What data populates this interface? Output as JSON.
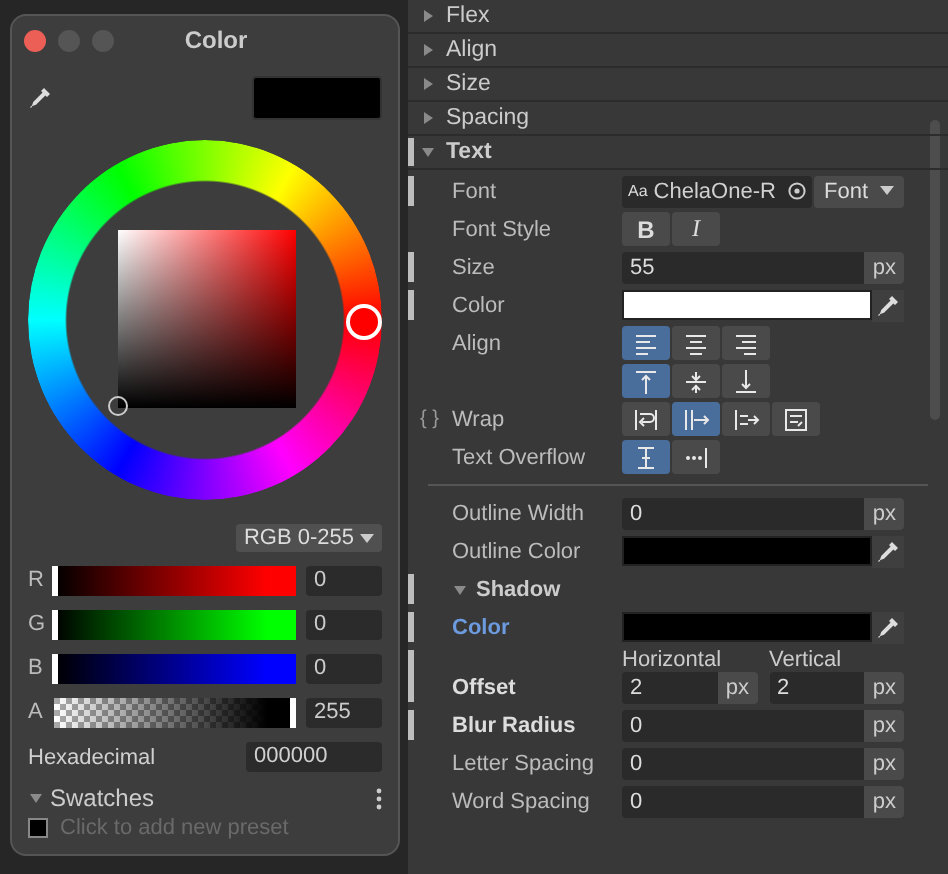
{
  "color_window": {
    "title": "Color",
    "mode": "RGB 0-255",
    "channels": [
      {
        "label": "R",
        "kind": "rgb",
        "color": "#ff0000",
        "level": 0,
        "value": "0"
      },
      {
        "label": "G",
        "kind": "rgb",
        "color": "#00ff00",
        "level": 0,
        "value": "0"
      },
      {
        "label": "B",
        "kind": "rgb",
        "color": "#0000ff",
        "level": 0,
        "value": "0"
      },
      {
        "label": "A",
        "kind": "alpha",
        "color": "#000000",
        "level": 1,
        "value": "255"
      }
    ],
    "hex_label": "Hexadecimal",
    "hex_value": "000000",
    "swatches": {
      "label": "Swatches",
      "expanded": true,
      "hint": "Click to add new preset"
    }
  },
  "inspector": {
    "sections": [
      {
        "label": "Flex",
        "expanded": false,
        "modified": false
      },
      {
        "label": "Align",
        "expanded": false,
        "modified": false
      },
      {
        "label": "Size",
        "expanded": false,
        "modified": false
      },
      {
        "label": "Spacing",
        "expanded": false,
        "modified": false
      },
      {
        "label": "Text",
        "expanded": true,
        "modified": true
      }
    ],
    "properties": [
      {
        "kind": "font",
        "label": "Font",
        "modified": true,
        "prefix": "Aa",
        "value": "ChelaOne-R",
        "button": "Font"
      },
      {
        "kind": "buttons",
        "label": "Font Style",
        "modified": false,
        "buttons": [
          {
            "text": "B",
            "selected": false,
            "italic": false
          },
          {
            "text": "I",
            "selected": false,
            "italic": true
          }
        ]
      },
      {
        "kind": "number",
        "label": "Size",
        "modified": true,
        "value": "55",
        "unit": "px"
      },
      {
        "kind": "color",
        "label": "Color",
        "modified": true,
        "color": "#ffffff"
      },
      {
        "kind": "h-align",
        "label": "Align",
        "modified": false,
        "icons": [
          {
            "selected": true
          },
          {
            "selected": false
          },
          {
            "selected": false
          }
        ]
      },
      {
        "kind": "v-align",
        "icons": [
          {
            "selected": true
          },
          {
            "selected": false
          },
          {
            "selected": false
          }
        ]
      },
      {
        "kind": "wrap",
        "label": "Wrap",
        "binding": "{ }",
        "modified": false,
        "icons": [
          {
            "selected": false
          },
          {
            "selected": true
          },
          {
            "selected": false
          },
          {
            "selected": false
          }
        ]
      },
      {
        "kind": "overflow",
        "label": "Text Overflow",
        "modified": false,
        "icons": [
          {
            "selected": true
          },
          {
            "selected": false
          }
        ]
      },
      {
        "kind": "divider"
      },
      {
        "kind": "number",
        "label": "Outline Width",
        "modified": false,
        "value": "0",
        "unit": "px"
      },
      {
        "kind": "color",
        "label": "Outline Color",
        "modified": false,
        "color": "#000000"
      },
      {
        "kind": "subsection",
        "label": "Shadow",
        "expanded": true,
        "modified": true
      },
      {
        "kind": "color",
        "label": "Color",
        "modified": true,
        "highlight": true,
        "color": "#000000"
      },
      {
        "kind": "pair",
        "label": "Offset",
        "modified": true,
        "fields": [
          {
            "label": "Horizontal",
            "value": "2",
            "unit": "px"
          },
          {
            "label": "Vertical",
            "value": "2",
            "unit": "px"
          }
        ]
      },
      {
        "kind": "number",
        "label": "Blur Radius",
        "modified": true,
        "bold": true,
        "value": "0",
        "unit": "px"
      },
      {
        "kind": "number",
        "label": "Letter Spacing",
        "modified": false,
        "value": "0",
        "unit": "px"
      },
      {
        "kind": "number",
        "label": "Word Spacing",
        "modified": false,
        "value": "0",
        "unit": "px"
      }
    ]
  }
}
